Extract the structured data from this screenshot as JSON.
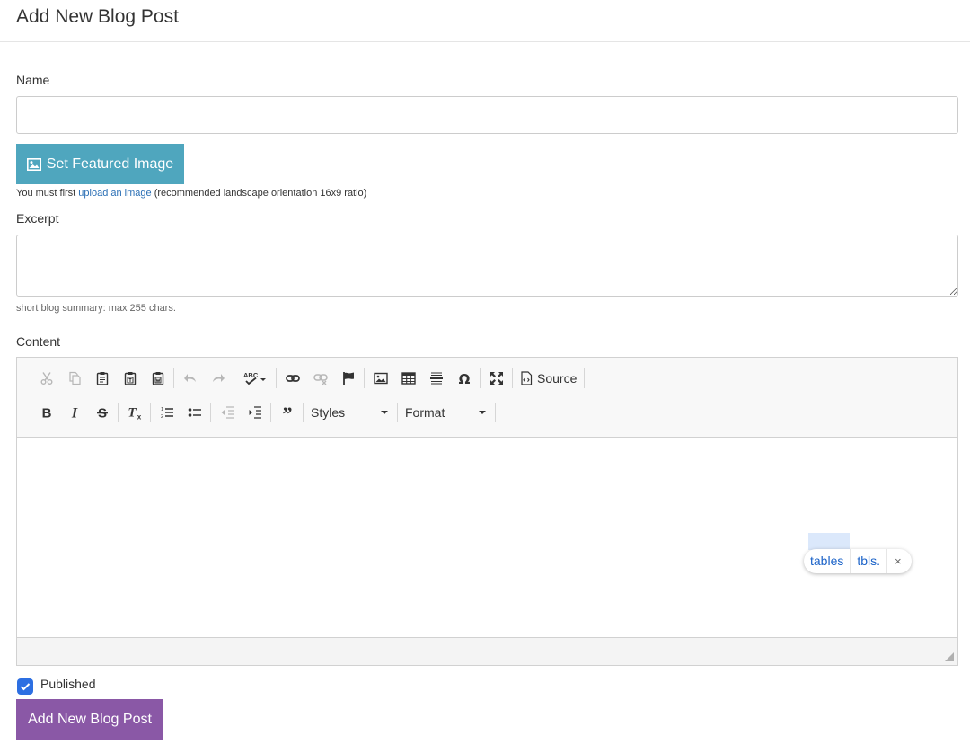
{
  "page": {
    "title": "Add New Blog Post"
  },
  "name_field": {
    "label": "Name",
    "value": "",
    "placeholder": ""
  },
  "featured_image": {
    "button_label": "Set Featured Image",
    "help_prefix": "You must first",
    "help_link": "upload an image",
    "help_suffix": "(recommended landscape orientation 16x9 ratio)"
  },
  "excerpt": {
    "label": "Excerpt",
    "value": "",
    "hint": "short blog summary: max 255 chars."
  },
  "content": {
    "label": "Content",
    "toolbar": {
      "source_label": "Source",
      "styles_label": "Styles",
      "format_label": "Format"
    },
    "body": ""
  },
  "spell_suggestions": {
    "items": [
      "tables",
      "tbls."
    ],
    "close": "×"
  },
  "published": {
    "label": "Published",
    "checked": true
  },
  "submit": {
    "label": "Add New Blog Post"
  },
  "colors": {
    "featured_button": "#4fa6be",
    "submit_button": "#8a58a6",
    "link": "#2a6fb5",
    "checkbox": "#2d6fe2",
    "suggestion_text": "#1a62c8"
  }
}
